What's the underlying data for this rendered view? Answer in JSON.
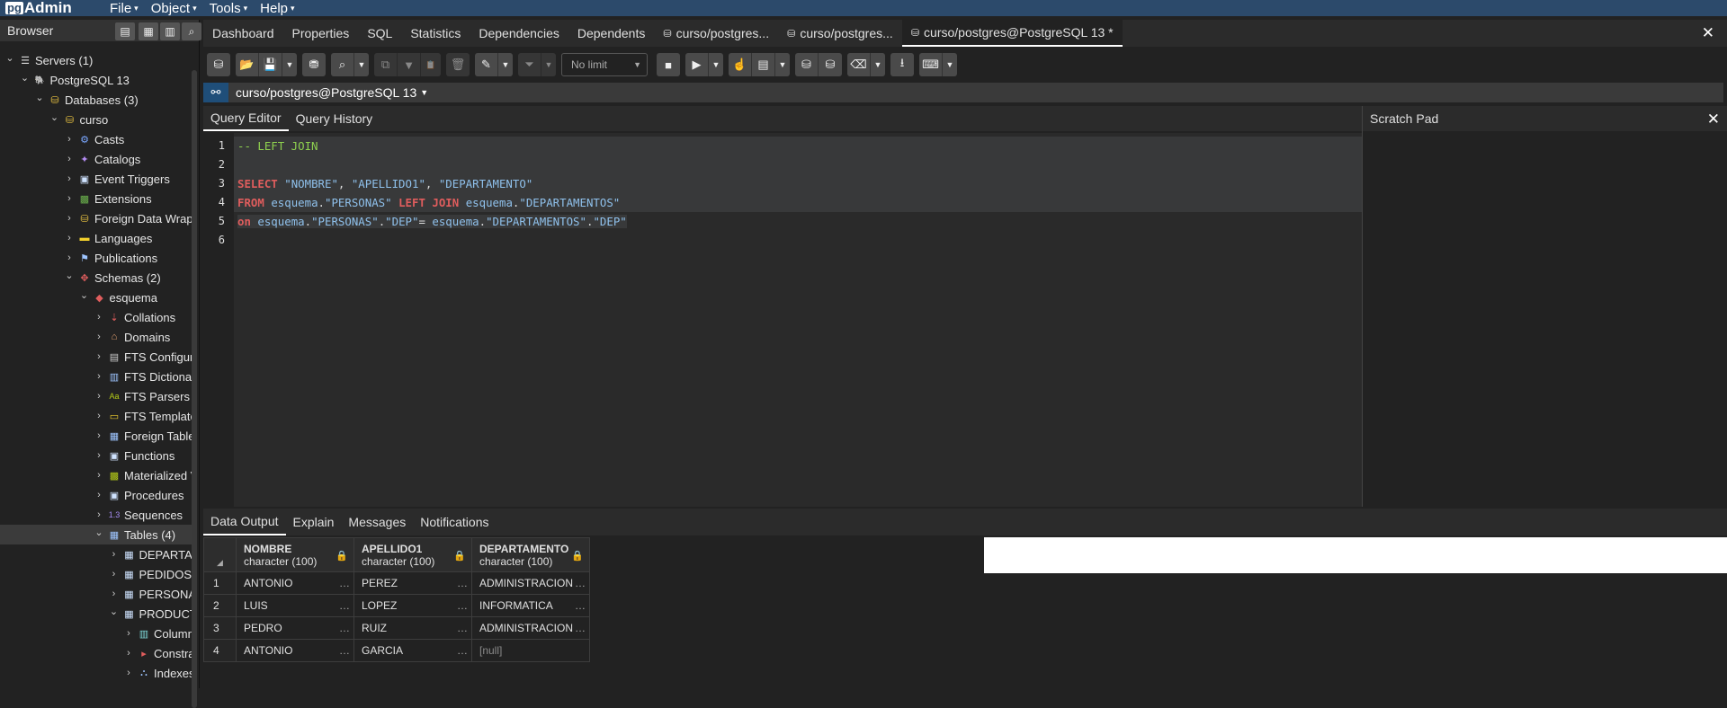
{
  "app": {
    "brand_pg": "pg",
    "brand_admin": "Admin"
  },
  "menu": [
    {
      "label": "File"
    },
    {
      "label": "Object"
    },
    {
      "label": "Tools"
    },
    {
      "label": "Help"
    }
  ],
  "browser": {
    "title": "Browser",
    "tree": [
      {
        "label": "Servers (1)",
        "level": 0,
        "chev": "v",
        "icon": "servers-icon"
      },
      {
        "label": "PostgreSQL 13",
        "level": 1,
        "chev": "v",
        "icon": "elephant-icon"
      },
      {
        "label": "Databases (3)",
        "level": 2,
        "chev": "v",
        "icon": "databases-icon"
      },
      {
        "label": "curso",
        "level": 3,
        "chev": "v",
        "icon": "database-icon"
      },
      {
        "label": "Casts",
        "level": 4,
        "chev": ">",
        "icon": "casts-icon"
      },
      {
        "label": "Catalogs",
        "level": 4,
        "chev": ">",
        "icon": "catalogs-icon"
      },
      {
        "label": "Event Triggers",
        "level": 4,
        "chev": ">",
        "icon": "event-triggers-icon"
      },
      {
        "label": "Extensions",
        "level": 4,
        "chev": ">",
        "icon": "extensions-icon"
      },
      {
        "label": "Foreign Data Wrappers",
        "level": 4,
        "chev": ">",
        "icon": "fdw-icon"
      },
      {
        "label": "Languages",
        "level": 4,
        "chev": ">",
        "icon": "languages-icon"
      },
      {
        "label": "Publications",
        "level": 4,
        "chev": ">",
        "icon": "publications-icon"
      },
      {
        "label": "Schemas (2)",
        "level": 4,
        "chev": "v",
        "icon": "schemas-icon"
      },
      {
        "label": "esquema",
        "level": 5,
        "chev": "v",
        "icon": "schema-icon"
      },
      {
        "label": "Collations",
        "level": 6,
        "chev": ">",
        "icon": "collations-icon"
      },
      {
        "label": "Domains",
        "level": 6,
        "chev": ">",
        "icon": "domains-icon"
      },
      {
        "label": "FTS Configurations",
        "level": 6,
        "chev": ">",
        "icon": "fts-config-icon"
      },
      {
        "label": "FTS Dictionaries",
        "level": 6,
        "chev": ">",
        "icon": "fts-dict-icon"
      },
      {
        "label": "FTS Parsers",
        "level": 6,
        "chev": ">",
        "icon": "fts-parsers-icon"
      },
      {
        "label": "FTS Templates",
        "level": 6,
        "chev": ">",
        "icon": "fts-templates-icon"
      },
      {
        "label": "Foreign Tables",
        "level": 6,
        "chev": ">",
        "icon": "foreign-tables-icon"
      },
      {
        "label": "Functions",
        "level": 6,
        "chev": ">",
        "icon": "functions-icon"
      },
      {
        "label": "Materialized Views",
        "level": 6,
        "chev": ">",
        "icon": "mat-views-icon"
      },
      {
        "label": "Procedures",
        "level": 6,
        "chev": ">",
        "icon": "procedures-icon"
      },
      {
        "label": "Sequences",
        "level": 6,
        "chev": ">",
        "icon": "sequences-icon"
      },
      {
        "label": "Tables (4)",
        "level": 6,
        "chev": "v",
        "icon": "tables-icon",
        "selected": true
      },
      {
        "label": "DEPARTAMENTOS",
        "level": 7,
        "chev": ">",
        "icon": "table-icon"
      },
      {
        "label": "PEDIDOS",
        "level": 7,
        "chev": ">",
        "icon": "table-icon"
      },
      {
        "label": "PERSONAS",
        "level": 7,
        "chev": ">",
        "icon": "table-icon"
      },
      {
        "label": "PRODUCTOS",
        "level": 7,
        "chev": "v",
        "icon": "table-icon"
      },
      {
        "label": "Columns",
        "level": 8,
        "chev": ">",
        "icon": "columns-icon"
      },
      {
        "label": "Constraints",
        "level": 8,
        "chev": ">",
        "icon": "constraints-icon"
      },
      {
        "label": "Indexes",
        "level": 8,
        "chev": ">",
        "icon": "indexes-icon"
      }
    ]
  },
  "tabs": [
    {
      "label": "Dashboard"
    },
    {
      "label": "Properties"
    },
    {
      "label": "SQL"
    },
    {
      "label": "Statistics"
    },
    {
      "label": "Dependencies"
    },
    {
      "label": "Dependents"
    },
    {
      "label": "curso/postgres...",
      "db": true
    },
    {
      "label": "curso/postgres...",
      "db": true
    },
    {
      "label": "curso/postgres@PostgreSQL 13 *",
      "db": true,
      "active": true
    }
  ],
  "toolbar": {
    "limit": "No limit"
  },
  "connection": {
    "name": "curso/postgres@PostgreSQL 13"
  },
  "query_tabs": [
    {
      "label": "Query Editor",
      "active": true
    },
    {
      "label": "Query History"
    }
  ],
  "scratch_pad": {
    "title": "Scratch Pad"
  },
  "editor": {
    "lines": [
      "1",
      "2",
      "3",
      "4",
      "5",
      "6"
    ]
  },
  "result_tabs": [
    {
      "label": "Data Output",
      "active": true
    },
    {
      "label": "Explain"
    },
    {
      "label": "Messages"
    },
    {
      "label": "Notifications"
    }
  ],
  "results": {
    "columns": [
      {
        "name": "NOMBRE",
        "type": "character (100)"
      },
      {
        "name": "APELLIDO1",
        "type": "character (100)"
      },
      {
        "name": "DEPARTAMENTO",
        "type": "character (100)"
      }
    ],
    "rows": [
      {
        "n": "1",
        "cells": [
          "ANTONIO",
          "PEREZ",
          "ADMINISTRACION"
        ]
      },
      {
        "n": "2",
        "cells": [
          "LUIS",
          "LOPEZ",
          "INFORMATICA"
        ]
      },
      {
        "n": "3",
        "cells": [
          "PEDRO",
          "RUIZ",
          "ADMINISTRACION"
        ]
      },
      {
        "n": "4",
        "cells": [
          "ANTONIO",
          "GARCIA",
          "[null]"
        ]
      }
    ]
  }
}
